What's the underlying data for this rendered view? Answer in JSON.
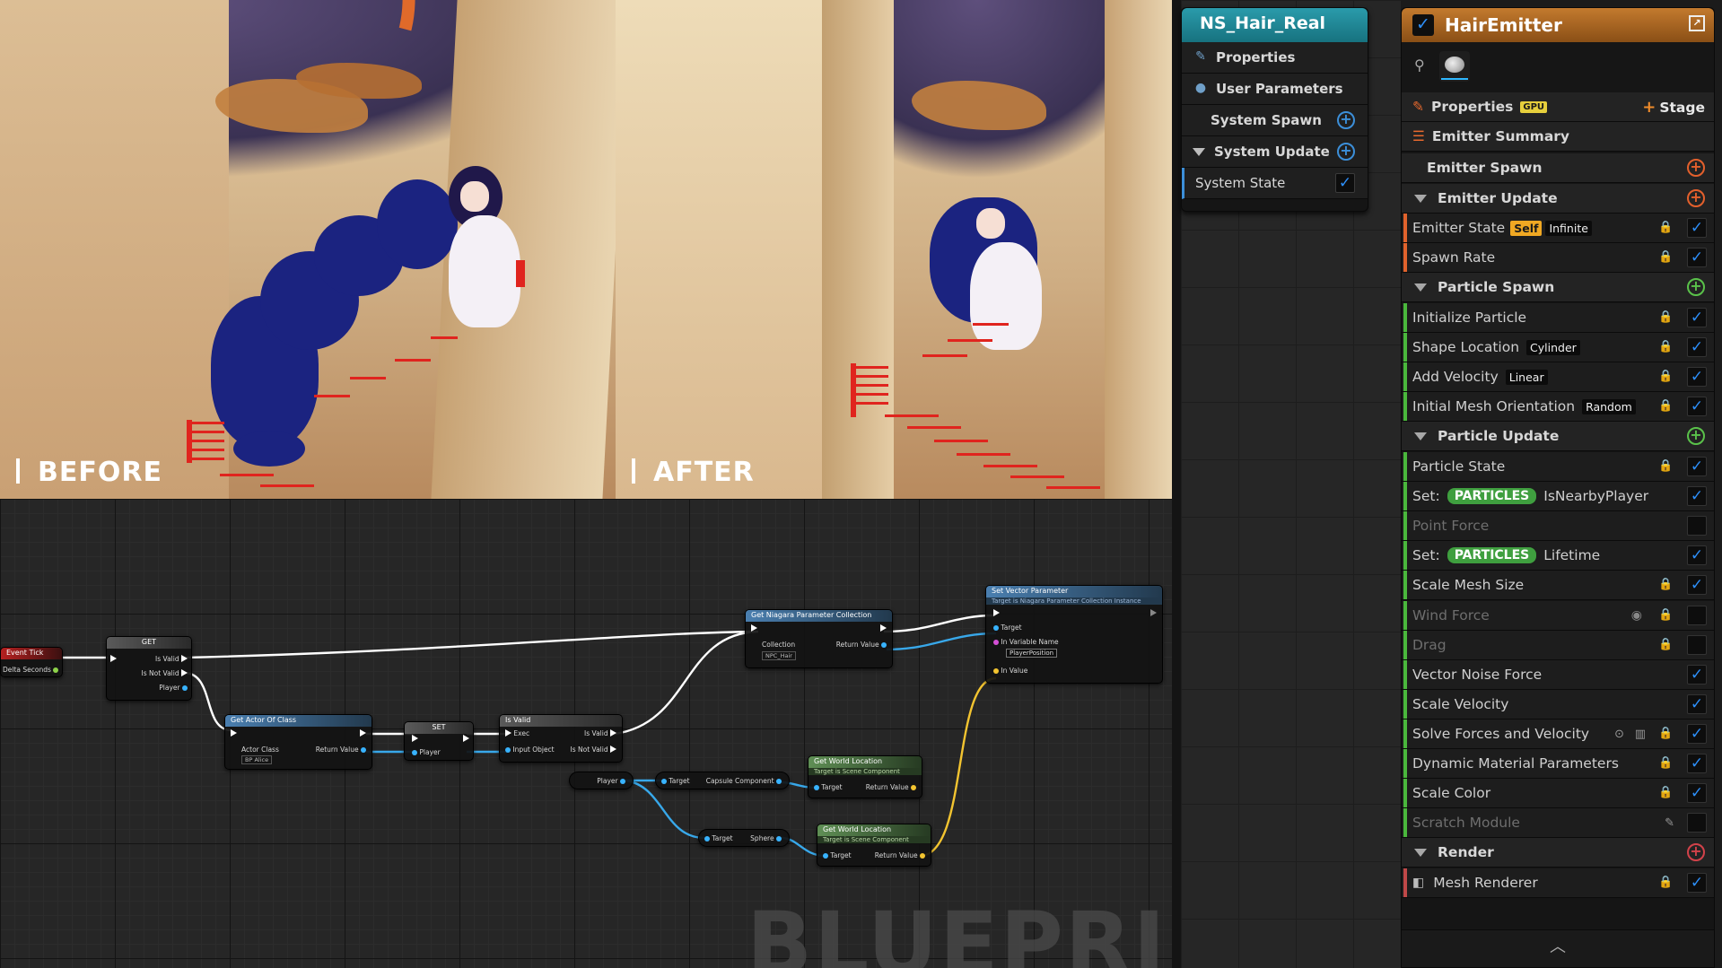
{
  "viewports": {
    "before_label": "BEFORE",
    "after_label": "AFTER"
  },
  "blueprint": {
    "watermark": "BLUEPRINT",
    "nodes": {
      "event_tick": {
        "title": "Event Tick",
        "delta": "Delta Seconds"
      },
      "get": {
        "title": "GET",
        "is_valid": "Is Valid",
        "is_not_valid": "Is Not Valid",
        "player": "Player"
      },
      "get_actor": {
        "title": "Get Actor Of Class",
        "actor_class": "Actor Class",
        "class_value": "BP Alice",
        "return": "Return Value"
      },
      "set": {
        "title": "SET",
        "player": "Player"
      },
      "is_valid": {
        "title": "Is Valid",
        "exec": "Exec",
        "input_object": "Input Object",
        "is_valid": "Is Valid",
        "is_not_valid": "Is Not Valid"
      },
      "get_npc": {
        "title": "Get Niagara Parameter Collection",
        "collection": "Collection",
        "collection_value": "NPC_Hair",
        "return": "Return Value"
      },
      "set_vector": {
        "title": "Set Vector Parameter",
        "subtitle": "Target is Niagara Parameter Collection Instance",
        "target": "Target",
        "in_var": "In Variable Name",
        "var_value": "PlayerPosition",
        "in_value": "In Value"
      },
      "player_var": {
        "label": "Player"
      },
      "capsule": {
        "target": "Target",
        "capsule": "Capsule Component"
      },
      "sphere": {
        "target": "Target",
        "sphere": "Sphere"
      },
      "world_loc_1": {
        "title": "Get World Location",
        "subtitle": "Target is Scene Component",
        "target": "Target",
        "return": "Return Value"
      },
      "world_loc_2": {
        "title": "Get World Location",
        "subtitle": "Target is Scene Component",
        "target": "Target",
        "return": "Return Value"
      }
    }
  },
  "system": {
    "title": "NS_Hair_Real",
    "rows": [
      {
        "label": "Properties",
        "icon": "pencil-icon"
      },
      {
        "label": "User Parameters",
        "icon": "user-icon"
      },
      {
        "label": "System Spawn",
        "icon": "add-icon"
      },
      {
        "label": "System Update",
        "icon": "add-icon"
      },
      {
        "label": "System State",
        "checked": true
      }
    ],
    "colors": {
      "title": "#1f8a98",
      "accent": "#3c8fd9"
    }
  },
  "emitter": {
    "title": "HairEmitter",
    "properties_label": "Properties",
    "gpu_badge": "GPU",
    "stage_label": "Stage",
    "summary_label": "Emitter Summary",
    "sections": {
      "emitter_spawn": "Emitter Spawn",
      "emitter_update": "Emitter Update",
      "particle_spawn": "Particle Spawn",
      "particle_update": "Particle Update",
      "render": "Render"
    },
    "modules": {
      "emitter_state": {
        "label": "Emitter State",
        "tag1": "Self",
        "tag2": "Infinite"
      },
      "spawn_rate": {
        "label": "Spawn Rate"
      },
      "initialize_particle": {
        "label": "Initialize Particle"
      },
      "shape_location": {
        "label": "Shape Location",
        "tag": "Cylinder"
      },
      "add_velocity": {
        "label": "Add Velocity",
        "tag": "Linear"
      },
      "initial_mesh": {
        "label": "Initial Mesh Orientation",
        "tag": "Random"
      },
      "particle_state": {
        "label": "Particle State"
      },
      "set_nearby": {
        "prefix": "Set:",
        "ns": "PARTICLES",
        "name": "IsNearbyPlayer"
      },
      "point_force": {
        "label": "Point Force"
      },
      "set_lifetime": {
        "prefix": "Set:",
        "ns": "PARTICLES",
        "name": "Lifetime"
      },
      "scale_mesh": {
        "label": "Scale Mesh Size"
      },
      "wind_force": {
        "label": "Wind Force"
      },
      "drag": {
        "label": "Drag"
      },
      "vector_noise": {
        "label": "Vector Noise Force"
      },
      "scale_velocity": {
        "label": "Scale Velocity"
      },
      "solve_forces": {
        "label": "Solve Forces and Velocity"
      },
      "dynamic_material": {
        "label": "Dynamic Material Parameters"
      },
      "scale_color": {
        "label": "Scale Color"
      },
      "scratch": {
        "label": "Scratch Module"
      },
      "mesh_renderer": {
        "label": "Mesh Renderer"
      }
    },
    "colors": {
      "title": "#b06a25",
      "spawn_rail": "#e0622c",
      "particle_rail": "#4ab83c",
      "render_rail": "#c04848",
      "particles_tag": "#3f9f3f"
    }
  }
}
